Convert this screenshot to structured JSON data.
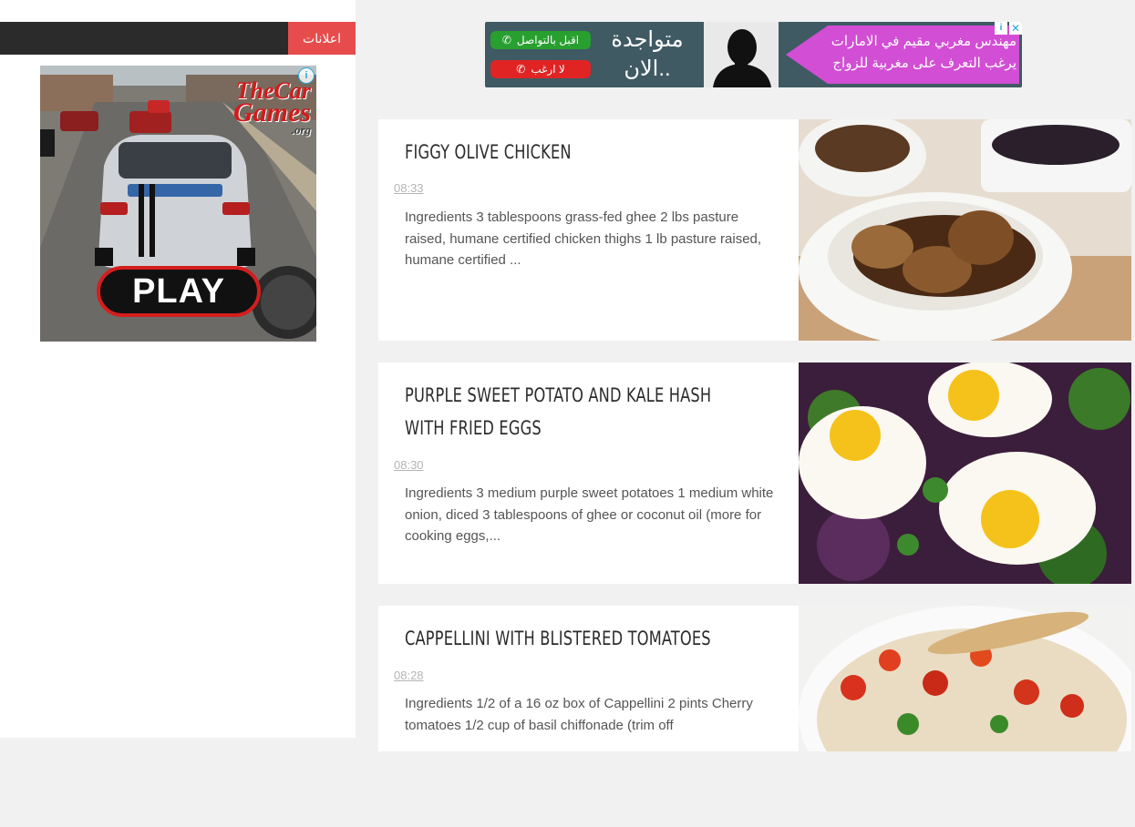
{
  "sidebar": {
    "header_label": "اعلانات",
    "game_ad": {
      "logo_line1": "TheCar",
      "logo_line2": "Games",
      "logo_line3": ".org",
      "play_label": "PLAY",
      "choices_icon": "i"
    }
  },
  "banner": {
    "accept_label": "اقبل بالتواصل",
    "reject_label": "لا ارغب",
    "online_text_line1": "متواجدة",
    "online_text_line2": "الان..",
    "message": "مهندس مغربي مقيم في الامارات يرغب التعرف على مغربية للزواج",
    "close_icon": "✕",
    "info_icon": "i",
    "colors": {
      "accent": "#d24ed4",
      "accept": "#28a030",
      "reject": "#e02424"
    }
  },
  "posts": [
    {
      "title": "FIGGY OLIVE CHICKEN",
      "time": "08:33",
      "excerpt": "Ingredients 3 tablespoons grass-fed ghee 2 lbs pasture raised, humane certified chicken thighs 1 lb pasture raised, humane certified ..."
    },
    {
      "title": "PURPLE SWEET POTATO AND KALE HASH WITH FRIED EGGS",
      "time": "08:30",
      "excerpt": "  Ingredients 3 medium purple sweet potatoes 1 medium white onion, diced 3 tablespoons of ghee or coconut oil (more for cooking eggs,..."
    },
    {
      "title": "CAPPELLINI WITH BLISTERED TOMATOES",
      "time": "08:28",
      "excerpt": "  Ingredients 1/2 of a 16 oz box of Cappellini 2 pints Cherry tomatoes 1/2 cup of basil chiffonade (trim off"
    }
  ],
  "colors": {
    "sidebar_header": "#2b2b2b",
    "sidebar_label_bg": "#e74c4c",
    "page_bg": "#f1f1f1"
  }
}
